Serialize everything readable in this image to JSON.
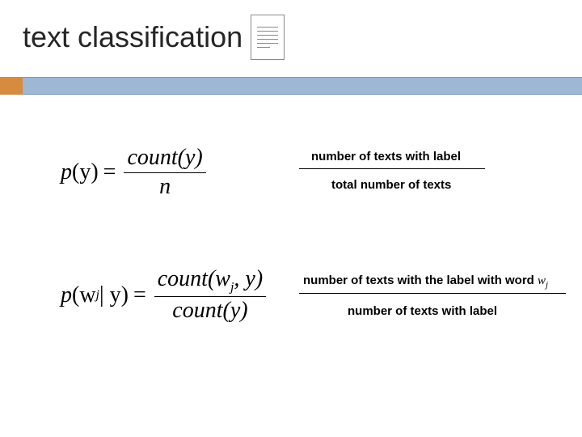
{
  "slide": {
    "title": "text classification"
  },
  "formula1": {
    "lhs_p": "p",
    "lhs_arg": "(y)",
    "eq": "=",
    "num": "count(y)",
    "den": "n",
    "explain_num": "number of texts with label",
    "explain_den": "total number of texts"
  },
  "formula2": {
    "lhs_p": "p",
    "lhs_arg_open": "(w",
    "lhs_arg_sub": "j",
    "lhs_arg_mid": " | y)",
    "eq": "=",
    "num_open": "count(w",
    "num_sub": "j",
    "num_close": ", y)",
    "den": "count(y)",
    "explain_num_a": "number of texts with the label with word ",
    "explain_num_w": "w",
    "explain_num_sub": "j",
    "explain_den": "number of texts with label"
  }
}
